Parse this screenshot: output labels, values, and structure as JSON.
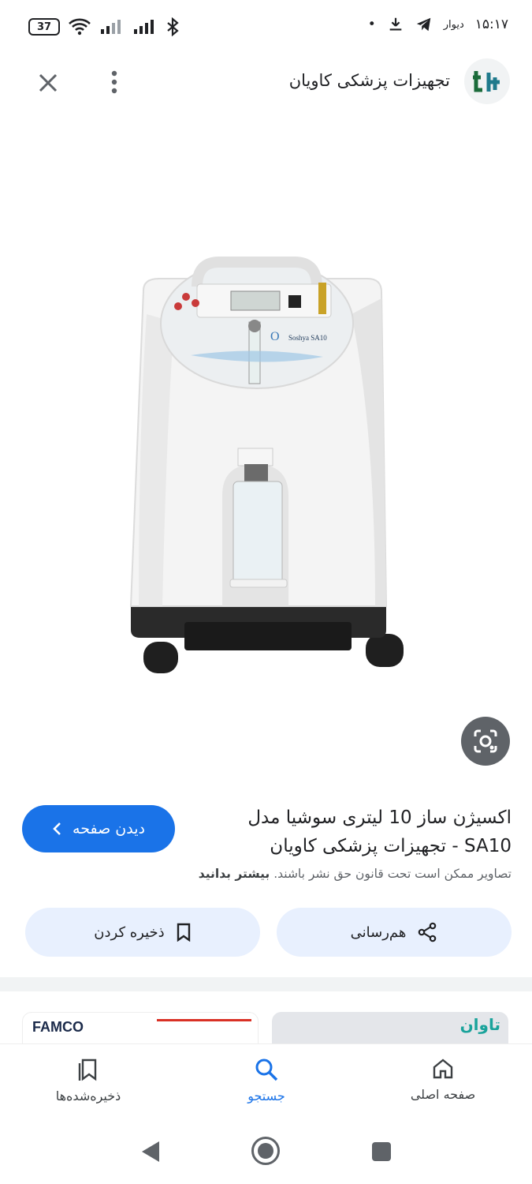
{
  "status_bar": {
    "time": "۱۵:۱۷",
    "carrier": "دیوار",
    "dot": "•",
    "battery": "37"
  },
  "header": {
    "site_name": "تجهیزات پزشکی کاویان",
    "logo_text": "tk"
  },
  "product_image": {
    "brand_label": "Soshya SA10"
  },
  "result": {
    "title": "اکسیژن ساز 10 لیتری سوشیا مدل SA10 - تجهیزات پزشکی کاویان",
    "visit_button": "دیدن صفحه",
    "copyright_text": "تصاویر ممکن است تحت قانون حق نشر باشند.",
    "learn_more": "بیشتر بدانید",
    "share_button": "هم‌رسانی",
    "save_button": "ذخیره کردن"
  },
  "related": {
    "left_brand": "FAMCO",
    "right_brand": "تاوان"
  },
  "bottom_nav": {
    "home": "صفحه اصلی",
    "search": "جستجو",
    "saved": "ذخیره‌شده‌ها"
  },
  "colors": {
    "accent": "#1a73e8",
    "action_bg": "#e8f0fe"
  }
}
